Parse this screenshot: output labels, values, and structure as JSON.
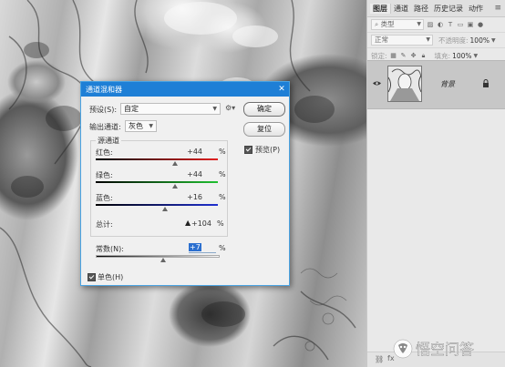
{
  "panel": {
    "tabs": [
      "图层",
      "通道",
      "路径",
      "历史记录",
      "动作"
    ],
    "kind_label": "类型",
    "blend_mode": "正常",
    "opacity_label": "不透明度:",
    "opacity_value": "100%",
    "lock_label": "锁定:",
    "fill_label": "填充:",
    "fill_value": "100%",
    "layer_name": "背景"
  },
  "dialog": {
    "title": "通道混和器",
    "preset_label": "预设(S):",
    "preset_value": "自定",
    "output_label": "输出通道:",
    "output_value": "灰色",
    "ok_label": "确定",
    "reset_label": "复位",
    "preview_label": "预览(P)",
    "preview_checked": true,
    "source_group_title": "源通道",
    "channels": [
      {
        "label": "红色:",
        "value": "+44",
        "unit": "%",
        "color": "#e02020"
      },
      {
        "label": "绿色:",
        "value": "+44",
        "unit": "%",
        "color": "#20c030"
      },
      {
        "label": "蓝色:",
        "value": "+16",
        "unit": "%",
        "color": "#2030d0"
      }
    ],
    "total_label": "总计:",
    "total_value": "+104",
    "total_unit": "%",
    "constant_label": "常数(N):",
    "constant_value": "+7",
    "constant_unit": "%",
    "mono_label": "单色(H)",
    "mono_checked": true
  },
  "watermark": {
    "text": "悟空问答"
  },
  "colors": {
    "titlebar": "#1e7fd6",
    "accent": "#4aa3e2"
  }
}
